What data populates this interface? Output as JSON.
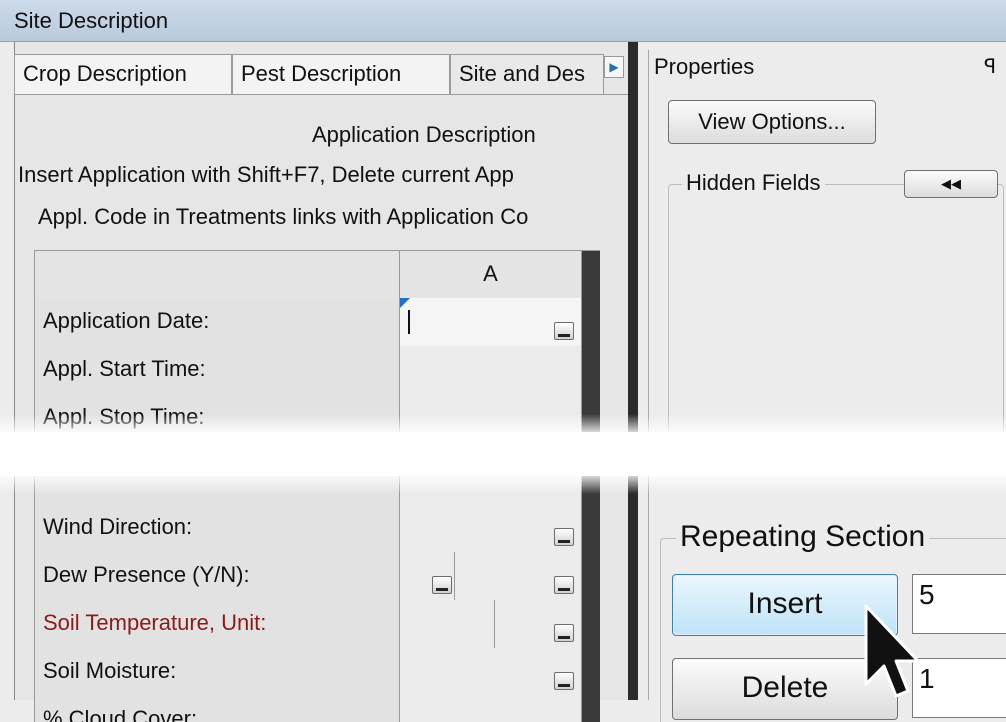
{
  "window": {
    "title": "Site Description"
  },
  "tabs": [
    "Crop Description",
    "Pest Description",
    "Site and Des"
  ],
  "section": {
    "title": "Application Description",
    "instruction": "Insert Application with Shift+F7, Delete current App",
    "note": "Appl. Code in Treatments links with Application Co"
  },
  "grid": {
    "column_header": "A",
    "rows_top": [
      "Application Date:",
      "Appl. Start Time:",
      "Appl. Stop Time:"
    ],
    "rows_bottom": [
      "Wind Direction:",
      "Dew Presence (Y/N):",
      "Soil Temperature, Unit:",
      "Soil Moisture:",
      "% Cloud Cover:"
    ]
  },
  "properties": {
    "title": "Properties",
    "pin_glyph": "ꟼ",
    "view_options_label": "View Options...",
    "hidden_fields_label": "Hidden Fields",
    "collapse_glyph": "◀◀"
  },
  "repeating": {
    "title": "Repeating Section",
    "insert_label": "Insert",
    "insert_value": "5",
    "delete_label": "Delete",
    "delete_value": "1"
  },
  "colors": {
    "required_label": "#8b1a1a",
    "accent_blue": "#2a6fb5"
  }
}
